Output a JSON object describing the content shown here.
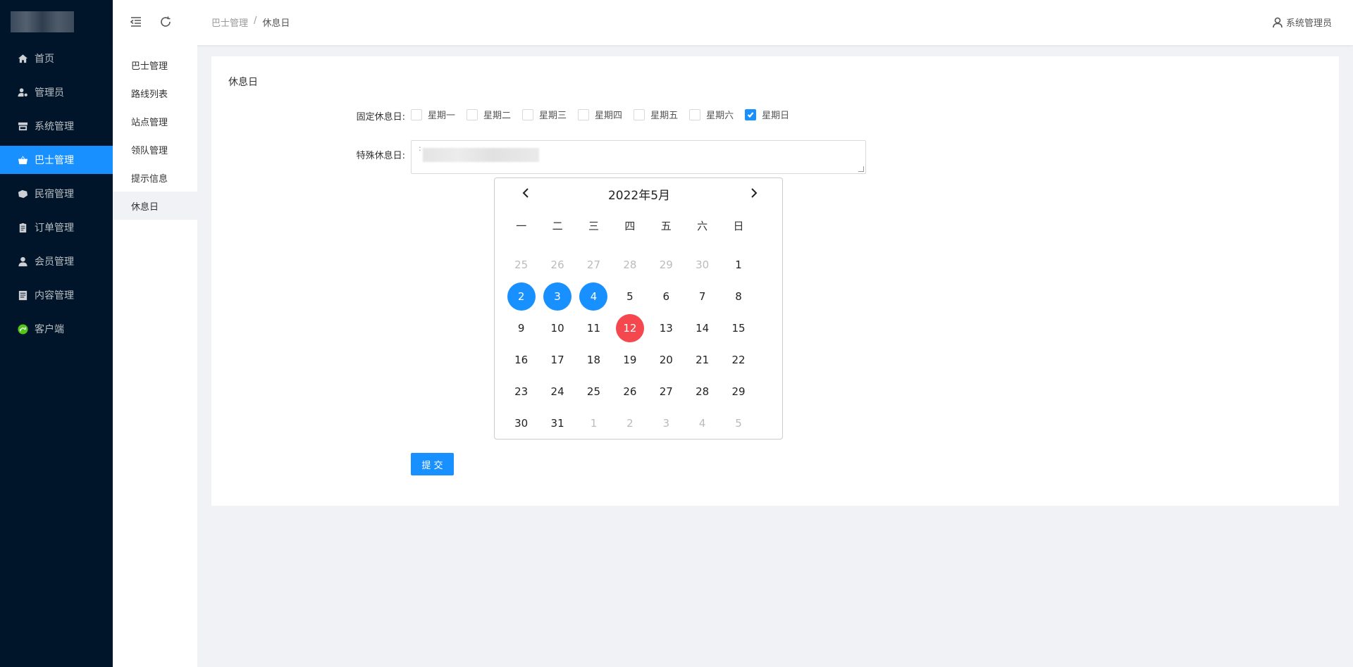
{
  "sidebar": {
    "items": [
      {
        "label": "首页",
        "icon": "home-icon"
      },
      {
        "label": "管理员",
        "icon": "user-key-icon"
      },
      {
        "label": "系统管理",
        "icon": "store-icon"
      },
      {
        "label": "巴士管理",
        "icon": "basket-icon",
        "active": true
      },
      {
        "label": "民宿管理",
        "icon": "leaf-icon"
      },
      {
        "label": "订单管理",
        "icon": "clipboard-icon"
      },
      {
        "label": "会员管理",
        "icon": "person-icon"
      },
      {
        "label": "内容管理",
        "icon": "document-icon"
      },
      {
        "label": "客户端",
        "icon": "mini-program-icon"
      }
    ]
  },
  "header": {
    "breadcrumb": [
      "巴士管理",
      "/",
      "休息日"
    ],
    "user": "系统管理员"
  },
  "subnav": {
    "items": [
      "巴士管理",
      "路线列表",
      "站点管理",
      "领队管理",
      "提示信息",
      "休息日"
    ],
    "active_index": 5
  },
  "main": {
    "title": "休息日",
    "fixed_label": "固定休息日:",
    "weekdays": [
      {
        "label": "星期一",
        "checked": false
      },
      {
        "label": "星期二",
        "checked": false
      },
      {
        "label": "星期三",
        "checked": false
      },
      {
        "label": "星期四",
        "checked": false
      },
      {
        "label": "星期五",
        "checked": false
      },
      {
        "label": "星期六",
        "checked": false
      },
      {
        "label": "星期日",
        "checked": true
      }
    ],
    "special_label": "特殊休息日:",
    "special_value_prefix": ":",
    "submit_label": "提 交"
  },
  "calendar": {
    "title": "2022年5月",
    "weekday_headers": [
      "一",
      "二",
      "三",
      "四",
      "五",
      "六",
      "日"
    ],
    "days": [
      {
        "d": "25",
        "state": "muted"
      },
      {
        "d": "26",
        "state": "muted"
      },
      {
        "d": "27",
        "state": "muted"
      },
      {
        "d": "28",
        "state": "muted"
      },
      {
        "d": "29",
        "state": "muted"
      },
      {
        "d": "30",
        "state": "muted"
      },
      {
        "d": "1",
        "state": ""
      },
      {
        "d": "2",
        "state": "sel"
      },
      {
        "d": "3",
        "state": "sel"
      },
      {
        "d": "4",
        "state": "sel"
      },
      {
        "d": "5",
        "state": ""
      },
      {
        "d": "6",
        "state": ""
      },
      {
        "d": "7",
        "state": ""
      },
      {
        "d": "8",
        "state": ""
      },
      {
        "d": "9",
        "state": ""
      },
      {
        "d": "10",
        "state": ""
      },
      {
        "d": "11",
        "state": ""
      },
      {
        "d": "12",
        "state": "today"
      },
      {
        "d": "13",
        "state": ""
      },
      {
        "d": "14",
        "state": ""
      },
      {
        "d": "15",
        "state": ""
      },
      {
        "d": "16",
        "state": ""
      },
      {
        "d": "17",
        "state": ""
      },
      {
        "d": "18",
        "state": ""
      },
      {
        "d": "19",
        "state": ""
      },
      {
        "d": "20",
        "state": ""
      },
      {
        "d": "21",
        "state": ""
      },
      {
        "d": "22",
        "state": ""
      },
      {
        "d": "23",
        "state": ""
      },
      {
        "d": "24",
        "state": ""
      },
      {
        "d": "25",
        "state": ""
      },
      {
        "d": "26",
        "state": ""
      },
      {
        "d": "27",
        "state": ""
      },
      {
        "d": "28",
        "state": ""
      },
      {
        "d": "29",
        "state": ""
      },
      {
        "d": "30",
        "state": ""
      },
      {
        "d": "31",
        "state": ""
      },
      {
        "d": "1",
        "state": "muted"
      },
      {
        "d": "2",
        "state": "muted"
      },
      {
        "d": "3",
        "state": "muted"
      },
      {
        "d": "4",
        "state": "muted"
      },
      {
        "d": "5",
        "state": "muted"
      }
    ]
  },
  "colors": {
    "sidebar_bg": "#001529",
    "accent": "#1890ff",
    "today": "#f5474e"
  }
}
